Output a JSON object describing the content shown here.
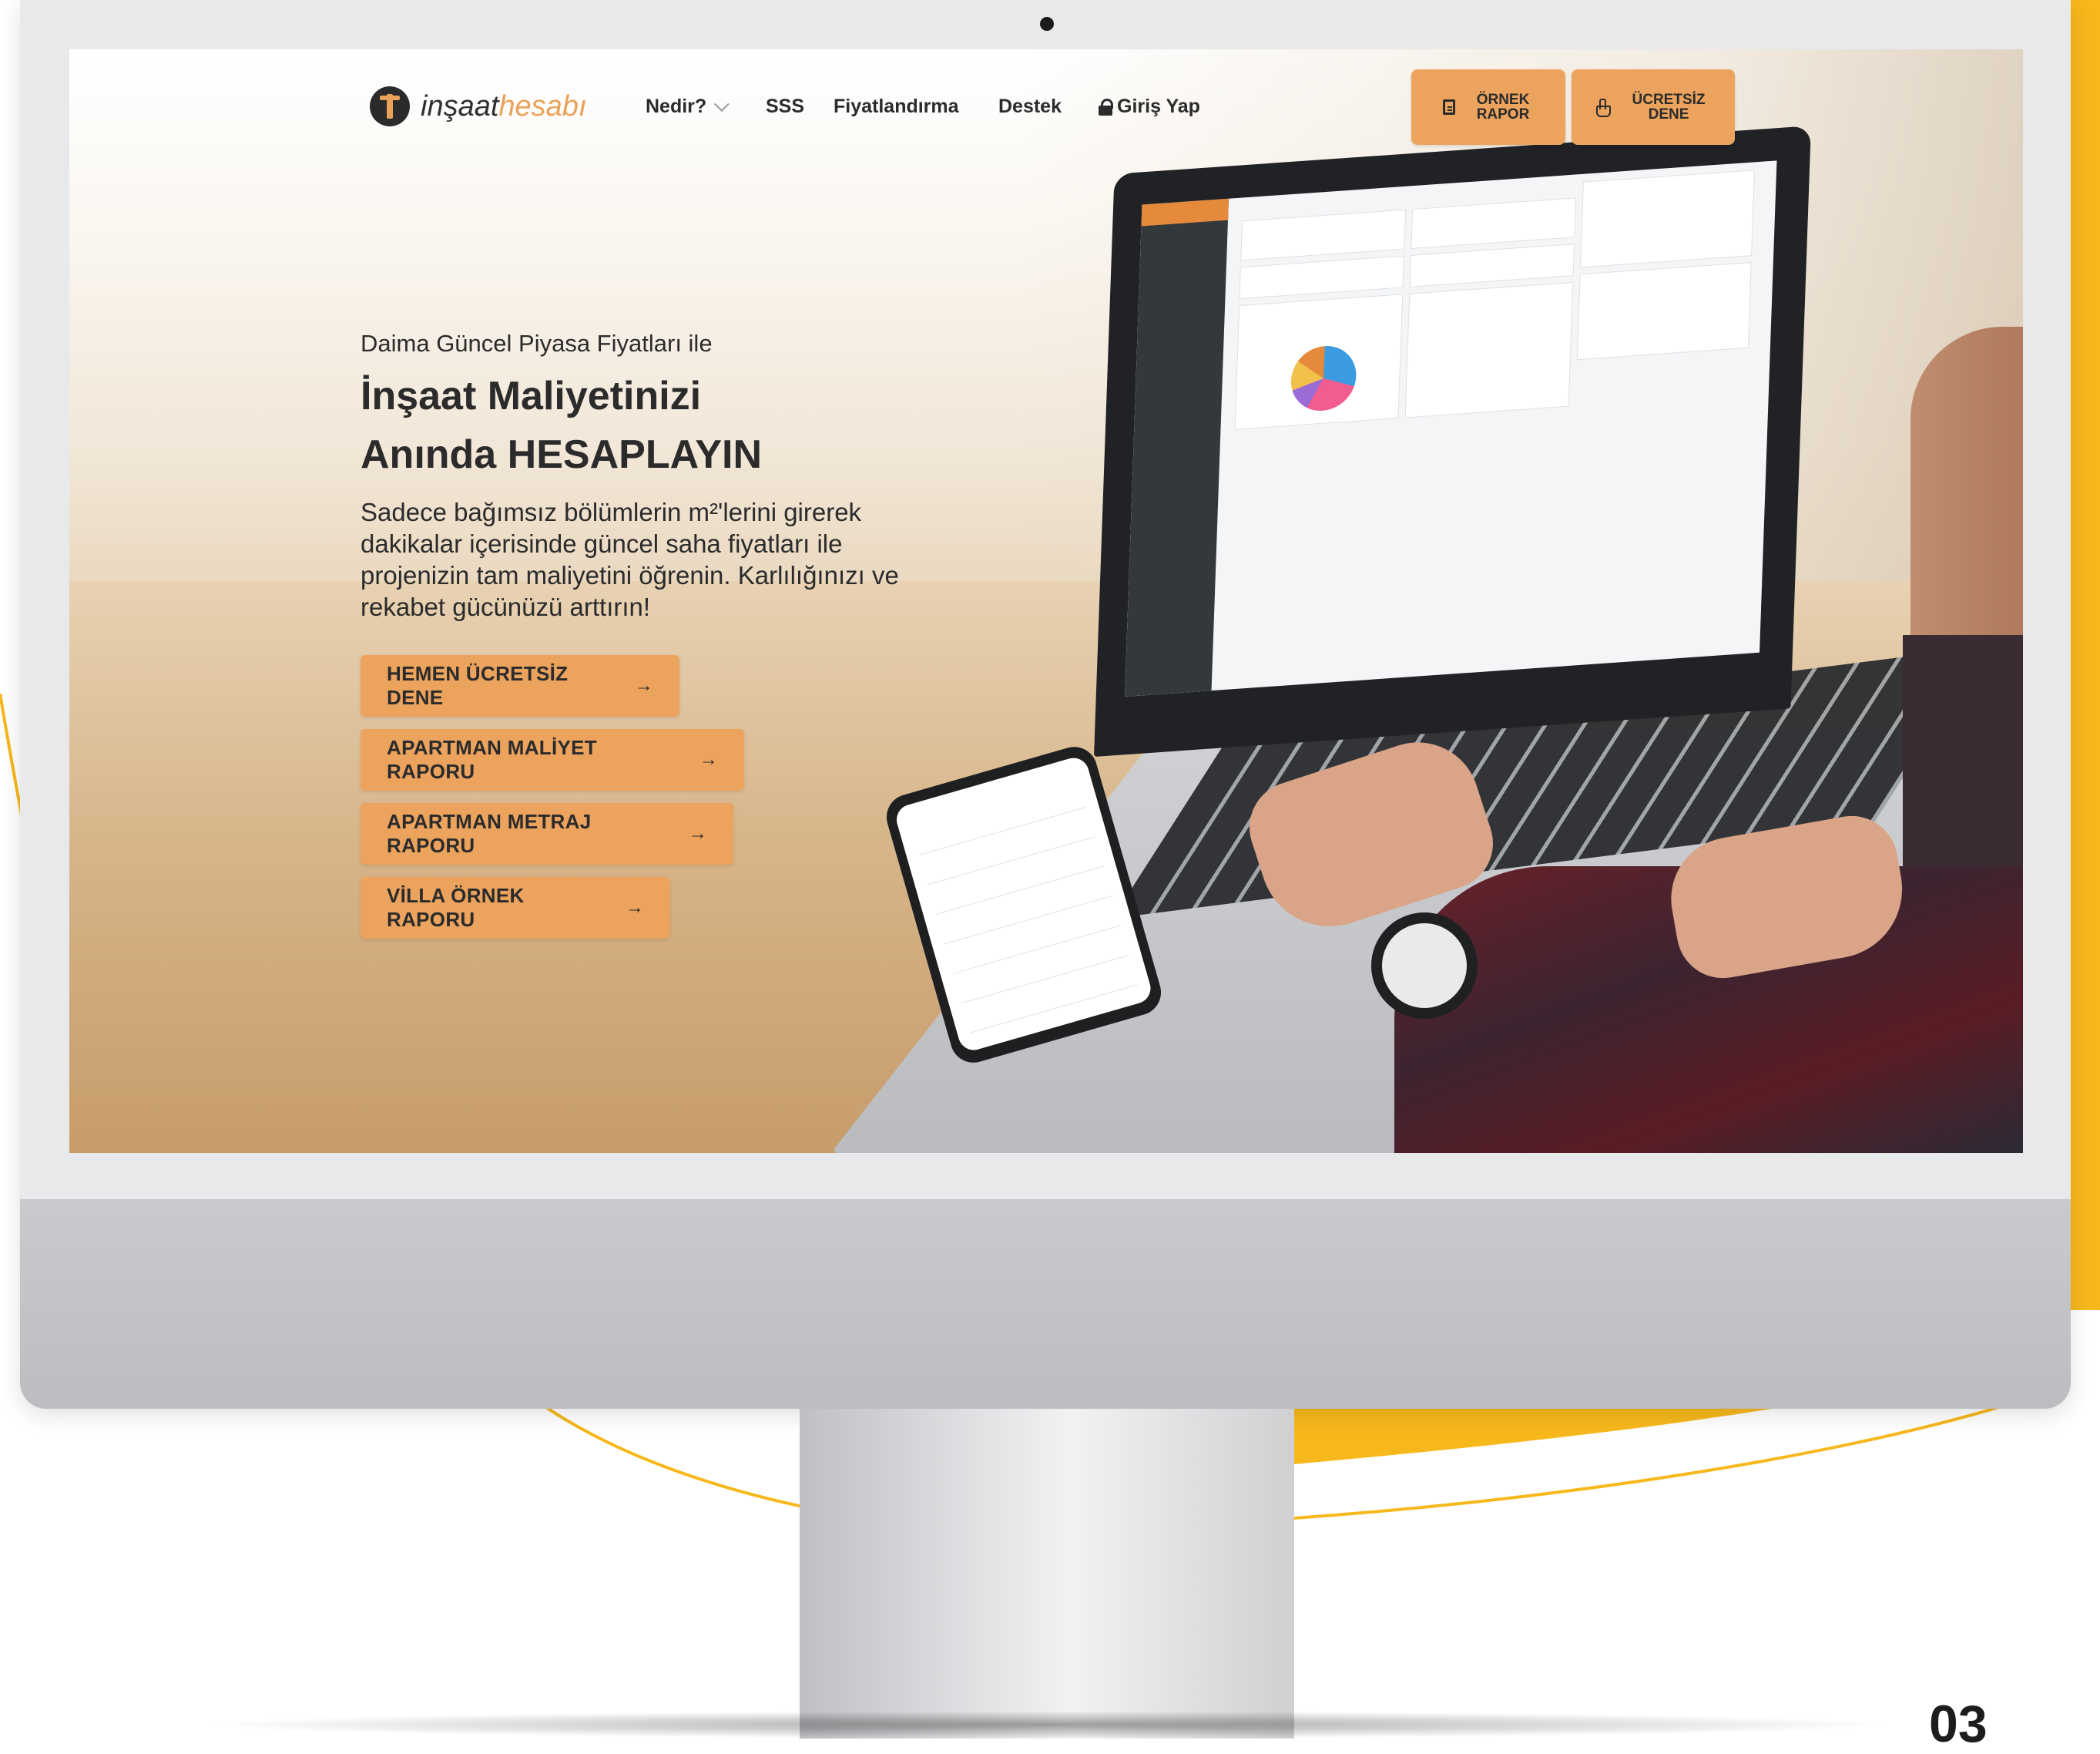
{
  "nav": {
    "logo_prefix": "inşaat",
    "logo_accent": "hesabı",
    "items": [
      {
        "label": "Nedir?"
      },
      {
        "label": "SSS"
      },
      {
        "label": "Fiyatlandırma"
      },
      {
        "label": "Destek"
      },
      {
        "label": "Giriş Yap"
      }
    ],
    "sample_report_label": "ÖRNEK RAPOR",
    "free_trial_label": "ÜCRETSİZ DENE"
  },
  "hero": {
    "subtitle": "Daima Güncel Piyasa Fiyatları ile",
    "title_line1": "İnşaat Maliyetinizi",
    "title_line2": "Anında HESAPLAYIN",
    "description": "Sadece bağımsız bölümlerin m²'lerini girerek dakikalar içerisinde güncel saha fiyatları ile projenizin tam maliyetini öğrenin. Karlılığınızı ve rekabet gücünüzü arttırın!",
    "buttons": [
      {
        "label": "HEMEN ÜCRETSİZ DENE"
      },
      {
        "label": "APARTMAN MALİYET RAPORU"
      },
      {
        "label": "APARTMAN METRAJ RAPORU"
      },
      {
        "label": "VİLLA ÖRNEK RAPORU"
      }
    ],
    "arrow_glyph": "→"
  },
  "page_number": "03",
  "colors": {
    "accent": "#eba35d",
    "decor_yellow": "#f7b81c",
    "text": "#2b2b2b"
  },
  "icons": [
    "logo-icon",
    "chevron-down-icon",
    "lock-icon",
    "document-icon",
    "hand-pointer-icon",
    "arrow-right-icon"
  ]
}
